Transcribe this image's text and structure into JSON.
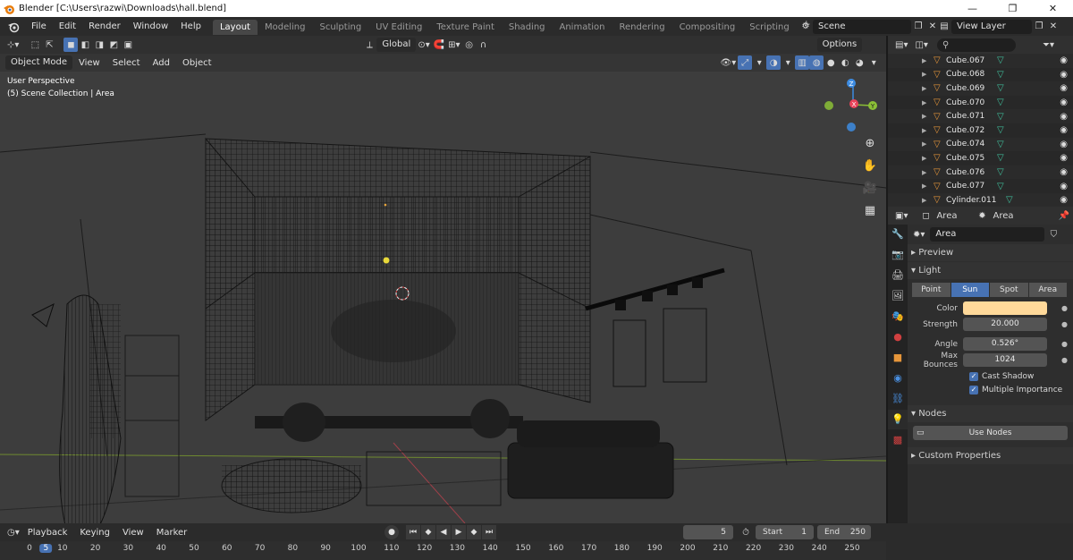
{
  "window": {
    "title": "Blender [C:\\Users\\razwi\\Downloads\\hall.blend]",
    "controls": [
      "—",
      "❐",
      "✕"
    ]
  },
  "menu": [
    "File",
    "Edit",
    "Render",
    "Window",
    "Help"
  ],
  "workspaces": [
    "Layout",
    "Modeling",
    "Sculpting",
    "UV Editing",
    "Texture Paint",
    "Shading",
    "Animation",
    "Rendering",
    "Compositing",
    "Scripting"
  ],
  "workspace_add": "+",
  "scene": {
    "name": "Scene",
    "view_layer": "View Layer"
  },
  "viewport": {
    "transform_orientation": "Global",
    "options_label": "Options",
    "mode": "Object Mode",
    "menus": [
      "View",
      "Select",
      "Add",
      "Object"
    ],
    "overlay_line1": "User Perspective",
    "overlay_line2": "(5) Scene Collection | Area",
    "gizmo": {
      "x": "X",
      "y": "Y",
      "z": "Z"
    }
  },
  "outliner": {
    "search_placeholder": "",
    "items": [
      {
        "name": "Cube.067"
      },
      {
        "name": "Cube.068"
      },
      {
        "name": "Cube.069"
      },
      {
        "name": "Cube.070"
      },
      {
        "name": "Cube.071"
      },
      {
        "name": "Cube.072"
      },
      {
        "name": "Cube.074"
      },
      {
        "name": "Cube.075"
      },
      {
        "name": "Cube.076"
      },
      {
        "name": "Cube.077"
      },
      {
        "name": "Cylinder.011"
      }
    ]
  },
  "properties": {
    "breadcrumb_object": "Area",
    "breadcrumb_data": "Area",
    "datablock": "Area",
    "panels": {
      "preview": "Preview",
      "light": "Light",
      "nodes": "Nodes",
      "custom": "Custom Properties"
    },
    "light_types": [
      "Point",
      "Sun",
      "Spot",
      "Area"
    ],
    "active_type": "Sun",
    "fields": {
      "color_label": "Color",
      "color_value": "#ffd99a",
      "strength_label": "Strength",
      "strength_value": "20.000",
      "angle_label": "Angle",
      "angle_value": "0.526°",
      "bounces_label": "Max Bounces",
      "bounces_value": "1024"
    },
    "checks": {
      "cast_shadow": "Cast Shadow",
      "multiple_importance": "Multiple Importance"
    },
    "use_nodes": "Use Nodes"
  },
  "timeline": {
    "menus": [
      "Playback",
      "Keying",
      "View",
      "Marker"
    ],
    "current_frame": "5",
    "start_label": "Start",
    "start_value": "1",
    "end_label": "End",
    "end_value": "250",
    "ticks": [
      "0",
      "5",
      "10",
      "20",
      "30",
      "40",
      "50",
      "60",
      "70",
      "80",
      "90",
      "100",
      "110",
      "120",
      "130",
      "140",
      "150",
      "160",
      "170",
      "180",
      "190",
      "200",
      "210",
      "220",
      "230",
      "240",
      "250"
    ]
  },
  "colors": {
    "accent": "#4772b3",
    "object_orange": "#e6963a",
    "mesh_green": "#3fbf9c",
    "axis_x": "#e8435a",
    "axis_y": "#8bbf36",
    "axis_z": "#3d8ce2"
  }
}
